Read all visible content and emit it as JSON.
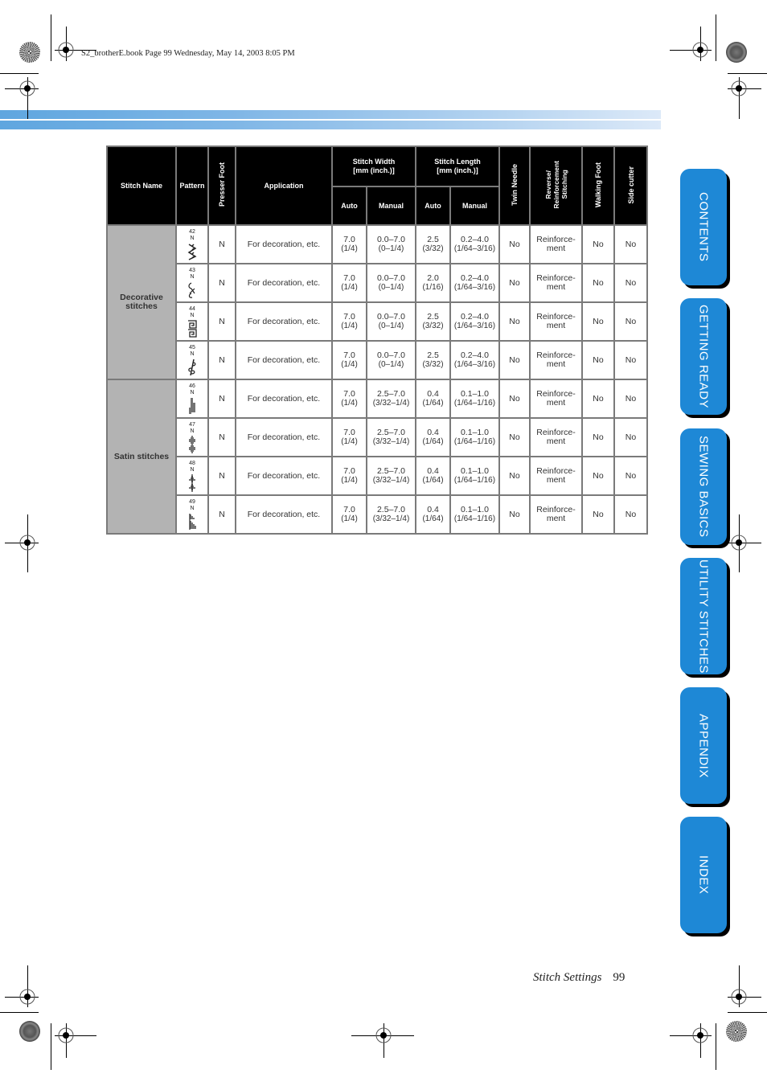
{
  "header": {
    "print_meta": "S2_brotherE.book  Page 99  Wednesday, May 14, 2003  8:05 PM"
  },
  "table": {
    "headers": {
      "stitch_name": "Stitch Name",
      "pattern": "Pattern",
      "presser_foot": "Presser Foot",
      "application": "Application",
      "stitch_width": "Stitch Width\n[mm (inch.)]",
      "stitch_length": "Stitch Length\n[mm (inch.)]",
      "twin_needle": "Twin Needle",
      "reverse": "Reverse/\nReinforcement\nStitching",
      "walking_foot": "Walking Foot",
      "side_cutter": "Side cutter",
      "auto": "Auto",
      "manual": "Manual"
    },
    "groups": [
      {
        "name": "Decorative\nstitches",
        "rows": [
          {
            "num": "42",
            "foot_code": "N",
            "presser_foot": "N",
            "application": "For decoration, etc.",
            "width_auto": "7.0",
            "width_auto_in": "(1/4)",
            "width_manual": "0.0–7.0",
            "width_manual_in": "(0–1/4)",
            "length_auto": "2.5",
            "length_auto_in": "(3/32)",
            "length_manual": "0.2–4.0",
            "length_manual_in": "(1/64–3/16)",
            "twin_needle": "No",
            "reverse": "Reinforce-\nment",
            "walking_foot": "No",
            "side_cutter": "No",
            "icon": "leaf-zigzag-stitch-icon"
          },
          {
            "num": "43",
            "foot_code": "N",
            "presser_foot": "N",
            "application": "For decoration, etc.",
            "width_auto": "7.0",
            "width_auto_in": "(1/4)",
            "width_manual": "0.0–7.0",
            "width_manual_in": "(0–1/4)",
            "length_auto": "2.0",
            "length_auto_in": "(1/16)",
            "length_manual": "0.2–4.0",
            "length_manual_in": "(1/64–3/16)",
            "twin_needle": "No",
            "reverse": "Reinforce-\nment",
            "walking_foot": "No",
            "side_cutter": "No",
            "icon": "scroll-stitch-icon"
          },
          {
            "num": "44",
            "foot_code": "N",
            "presser_foot": "N",
            "application": "For decoration, etc.",
            "width_auto": "7.0",
            "width_auto_in": "(1/4)",
            "width_manual": "0.0–7.0",
            "width_manual_in": "(0–1/4)",
            "length_auto": "2.5",
            "length_auto_in": "(3/32)",
            "length_manual": "0.2–4.0",
            "length_manual_in": "(1/64–3/16)",
            "twin_needle": "No",
            "reverse": "Reinforce-\nment",
            "walking_foot": "No",
            "side_cutter": "No",
            "icon": "greek-key-stitch-icon"
          },
          {
            "num": "45",
            "foot_code": "N",
            "presser_foot": "N",
            "application": "For decoration, etc.",
            "width_auto": "7.0",
            "width_auto_in": "(1/4)",
            "width_manual": "0.0–7.0",
            "width_manual_in": "(0–1/4)",
            "length_auto": "2.5",
            "length_auto_in": "(3/32)",
            "length_manual": "0.2–4.0",
            "length_manual_in": "(1/64–3/16)",
            "twin_needle": "No",
            "reverse": "Reinforce-\nment",
            "walking_foot": "No",
            "side_cutter": "No",
            "icon": "vine-stitch-icon"
          }
        ]
      },
      {
        "name": "Satin stitches",
        "rows": [
          {
            "num": "46",
            "foot_code": "N",
            "presser_foot": "N",
            "application": "For decoration, etc.",
            "width_auto": "7.0",
            "width_auto_in": "(1/4)",
            "width_manual": "2.5–7.0",
            "width_manual_in": "(3/32–1/4)",
            "length_auto": "0.4",
            "length_auto_in": "(1/64)",
            "length_manual": "0.1–1.0",
            "length_manual_in": "(1/64–1/16)",
            "twin_needle": "No",
            "reverse": "Reinforce-\nment",
            "walking_foot": "No",
            "side_cutter": "No",
            "icon": "step-satin-stitch-icon"
          },
          {
            "num": "47",
            "foot_code": "N",
            "presser_foot": "N",
            "application": "For decoration, etc.",
            "width_auto": "7.0",
            "width_auto_in": "(1/4)",
            "width_manual": "2.5–7.0",
            "width_manual_in": "(3/32–1/4)",
            "length_auto": "0.4",
            "length_auto_in": "(1/64)",
            "length_manual": "0.1–1.0",
            "length_manual_in": "(1/64–1/16)",
            "twin_needle": "No",
            "reverse": "Reinforce-\nment",
            "walking_foot": "No",
            "side_cutter": "No",
            "icon": "oval-satin-stitch-icon"
          },
          {
            "num": "48",
            "foot_code": "N",
            "presser_foot": "N",
            "application": "For decoration, etc.",
            "width_auto": "7.0",
            "width_auto_in": "(1/4)",
            "width_manual": "2.5–7.0",
            "width_manual_in": "(3/32–1/4)",
            "length_auto": "0.4",
            "length_auto_in": "(1/64)",
            "length_manual": "0.1–1.0",
            "length_manual_in": "(1/64–1/16)",
            "twin_needle": "No",
            "reverse": "Reinforce-\nment",
            "walking_foot": "No",
            "side_cutter": "No",
            "icon": "diamond-satin-stitch-icon"
          },
          {
            "num": "49",
            "foot_code": "N",
            "presser_foot": "N",
            "application": "For decoration, etc.",
            "width_auto": "7.0",
            "width_auto_in": "(1/4)",
            "width_manual": "2.5–7.0",
            "width_manual_in": "(3/32–1/4)",
            "length_auto": "0.4",
            "length_auto_in": "(1/64)",
            "length_manual": "0.1–1.0",
            "length_manual_in": "(1/64–1/16)",
            "twin_needle": "No",
            "reverse": "Reinforce-\nment",
            "walking_foot": "No",
            "side_cutter": "No",
            "icon": "wedge-satin-stitch-icon"
          }
        ]
      }
    ]
  },
  "side_tabs": [
    {
      "label": "CONTENTS"
    },
    {
      "label": "GETTING READY"
    },
    {
      "label": "SEWING BASICS"
    },
    {
      "label": "UTILITY STITCHES"
    },
    {
      "label": "APPENDIX"
    },
    {
      "label": "INDEX"
    }
  ],
  "colors": {
    "tab_blue": "#1e88d6",
    "header_black": "#000000",
    "group_gray": "#b3b3b3",
    "band_start": "#5fa6df",
    "band_end": "#dce9f8"
  },
  "footer": {
    "section_title": "Stitch Settings",
    "page_number": "99"
  }
}
